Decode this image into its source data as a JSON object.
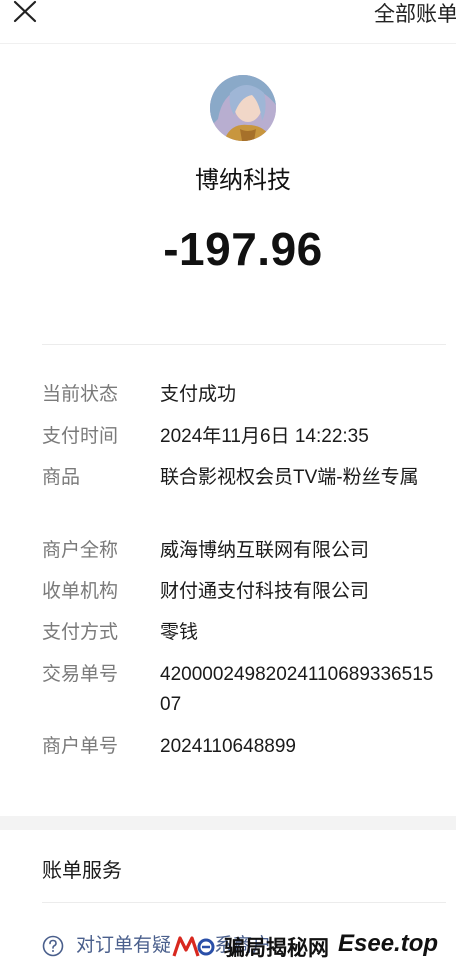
{
  "header": {
    "all_bills_label": "全部账单"
  },
  "summary": {
    "merchant": "博纳科技",
    "amount": "-197.96"
  },
  "details": [
    {
      "label": "当前状态",
      "value": "支付成功"
    },
    {
      "label": "支付时间",
      "value": "2024年11月6日 14:22:35"
    },
    {
      "label": "商品",
      "value": "联合影视权会员TV端-粉丝专属"
    },
    {
      "label": "商户全称",
      "value": "威海博纳互联网有限公司"
    },
    {
      "label": "收单机构",
      "value": "财付通支付科技有限公司"
    },
    {
      "label": "支付方式",
      "value": "零钱"
    },
    {
      "label": "交易单号",
      "value": "4200002498202411068933651507"
    },
    {
      "label": "商户单号",
      "value": "2024110648899"
    }
  ],
  "services": {
    "title": "账单服务",
    "help_text": "对订单有疑问 联系商户"
  },
  "watermark": {
    "text": "骗局揭秘网",
    "domain": "Esee.top"
  },
  "colors": {
    "link": "#4a5f8c",
    "label": "#7a7a7a"
  }
}
